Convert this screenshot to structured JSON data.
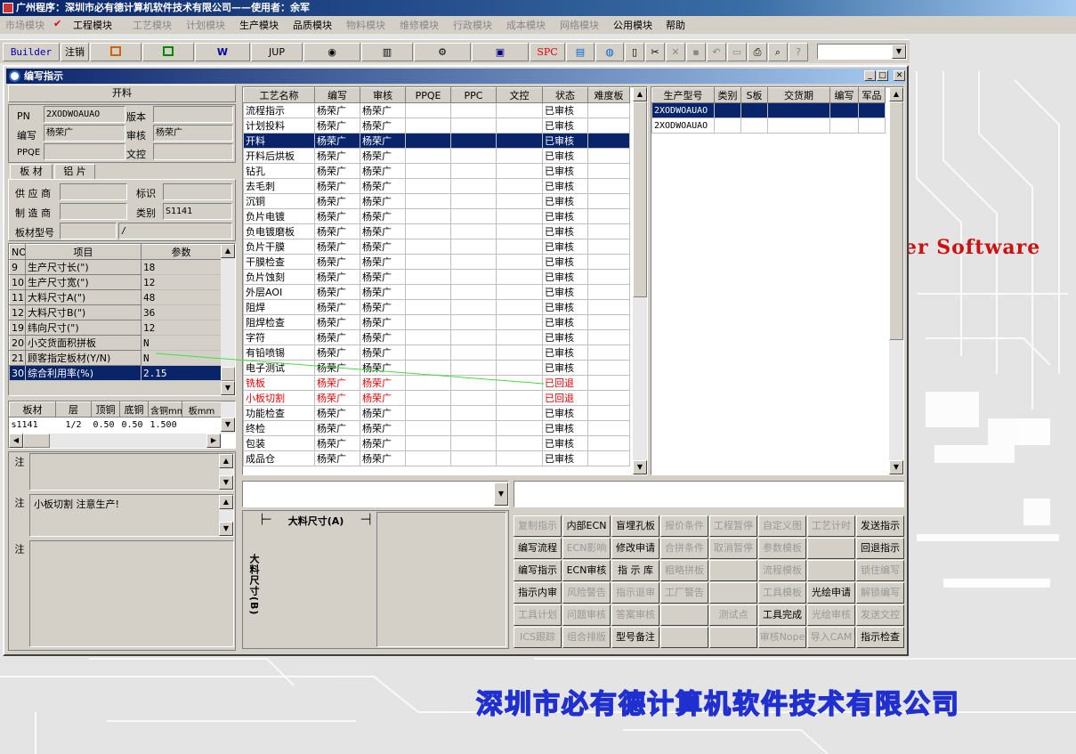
{
  "app_title": "广州程序：深圳市必有德计算机软件技术有限公司——使用者：余军",
  "menu": [
    "市场模块",
    "工程模块",
    "工艺模块",
    "计划模块",
    "生产模块",
    "品质模块",
    "物料模块",
    "维修模块",
    "行政模块",
    "成本模块",
    "网络模块",
    "公用模块",
    "帮助"
  ],
  "toolbar": {
    "builder": "Builder",
    "logout": "注销",
    "jup": "JUP",
    "spc": "SPC"
  },
  "window": {
    "title": "编写指示"
  },
  "left": {
    "section_title": "开料",
    "pn_label": "PN",
    "pn_value": "2XODWOAUAO",
    "version_label": "版本",
    "version_value": "",
    "author_label": "编写",
    "author_value": "杨荣广",
    "reviewer_label": "审核",
    "reviewer_value": "杨荣广",
    "ppqe_label": "PPQE",
    "ppqe_value": "",
    "doc_label": "文控",
    "doc_value": "",
    "tabs": [
      "板 材",
      "铝 片"
    ],
    "supplier_label": "供 应 商",
    "supplier_value": "",
    "mark_label": "标识",
    "mark_value": "",
    "maker_label": "制 造 商",
    "maker_value": "",
    "type_label": "类别",
    "type_value": "S1141",
    "model_label": "板材型号",
    "model_value": "",
    "model_value2": "/"
  },
  "params_table": {
    "headers": [
      "NO",
      "项目",
      "参数"
    ],
    "rows": [
      [
        "9",
        "生产尺寸长(\")",
        "18"
      ],
      [
        "10",
        "生产尺寸宽(\")",
        "12"
      ],
      [
        "11",
        "大料尺寸A(\")",
        "48"
      ],
      [
        "12",
        "大料尺寸B(\")",
        "36"
      ],
      [
        "19",
        "纬向尺寸(\")",
        "12"
      ],
      [
        "20",
        "小交货面积拼板",
        "N"
      ],
      [
        "21",
        "顾客指定板材(Y/N)",
        "N"
      ],
      [
        "30",
        "综合利用率(%)",
        "2.15"
      ]
    ]
  },
  "material_table": {
    "headers": [
      "板材",
      "层",
      "顶铜",
      "底铜",
      "含铜mm",
      "板mm"
    ],
    "row": [
      "s1141",
      "1/2",
      "0.50",
      "0.50",
      "1.500",
      ""
    ]
  },
  "remarks": {
    "process_label": "工艺备注",
    "model_label": "型号备注",
    "model_text": "小板切割 注意生产!",
    "order_label": "订单备注"
  },
  "process_table": {
    "headers": [
      "工艺名称",
      "编写",
      "审核",
      "PPQE",
      "PPC",
      "文控",
      "状态",
      "难度板"
    ],
    "rows": [
      [
        "流程指示",
        "杨荣广",
        "杨荣广",
        "",
        "",
        "",
        "已审核",
        ""
      ],
      [
        "计划投料",
        "杨荣广",
        "杨荣广",
        "",
        "",
        "",
        "已审核",
        ""
      ],
      [
        "开料",
        "杨荣广",
        "杨荣广",
        "",
        "",
        "",
        "已审核",
        ""
      ],
      [
        "开料后烘板",
        "杨荣广",
        "杨荣广",
        "",
        "",
        "",
        "已审核",
        ""
      ],
      [
        "钻孔",
        "杨荣广",
        "杨荣广",
        "",
        "",
        "",
        "已审核",
        ""
      ],
      [
        "去毛刺",
        "杨荣广",
        "杨荣广",
        "",
        "",
        "",
        "已审核",
        ""
      ],
      [
        "沉铜",
        "杨荣广",
        "杨荣广",
        "",
        "",
        "",
        "已审核",
        ""
      ],
      [
        "负片电镀",
        "杨荣广",
        "杨荣广",
        "",
        "",
        "",
        "已审核",
        ""
      ],
      [
        "负电镀磨板",
        "杨荣广",
        "杨荣广",
        "",
        "",
        "",
        "已审核",
        ""
      ],
      [
        "负片干膜",
        "杨荣广",
        "杨荣广",
        "",
        "",
        "",
        "已审核",
        ""
      ],
      [
        "干膜检查",
        "杨荣广",
        "杨荣广",
        "",
        "",
        "",
        "已审核",
        ""
      ],
      [
        "负片蚀刻",
        "杨荣广",
        "杨荣广",
        "",
        "",
        "",
        "已审核",
        ""
      ],
      [
        "外层AOI",
        "杨荣广",
        "杨荣广",
        "",
        "",
        "",
        "已审核",
        ""
      ],
      [
        "阻焊",
        "杨荣广",
        "杨荣广",
        "",
        "",
        "",
        "已审核",
        ""
      ],
      [
        "阻焊检查",
        "杨荣广",
        "杨荣广",
        "",
        "",
        "",
        "已审核",
        ""
      ],
      [
        "字符",
        "杨荣广",
        "杨荣广",
        "",
        "",
        "",
        "已审核",
        ""
      ],
      [
        "有铅喷锡",
        "杨荣广",
        "杨荣广",
        "",
        "",
        "",
        "已审核",
        ""
      ],
      [
        "电子测试",
        "杨荣广",
        "杨荣广",
        "",
        "",
        "",
        "已审核",
        ""
      ],
      [
        "铣板",
        "杨荣广",
        "杨荣广",
        "",
        "",
        "",
        "已回退",
        ""
      ],
      [
        "小板切割",
        "杨荣广",
        "杨荣广",
        "",
        "",
        "",
        "已回退",
        ""
      ],
      [
        "功能检查",
        "杨荣广",
        "杨荣广",
        "",
        "",
        "",
        "已审核",
        ""
      ],
      [
        "终检",
        "杨荣广",
        "杨荣广",
        "",
        "",
        "",
        "已审核",
        ""
      ],
      [
        "包装",
        "杨荣广",
        "杨荣广",
        "",
        "",
        "",
        "已审核",
        ""
      ],
      [
        "成品仓",
        "杨荣广",
        "杨荣广",
        "",
        "",
        "",
        "已审核",
        ""
      ]
    ],
    "selected_index": 2,
    "red_indices": [
      18,
      19
    ]
  },
  "model_table": {
    "headers": [
      "生产型号",
      "类别",
      "S板",
      "交货期",
      "编写",
      "军品"
    ],
    "rows": [
      [
        "2XODWOAUAO",
        "",
        "",
        "",
        "",
        ""
      ],
      [
        "2XODWOAUAO",
        "",
        "",
        "",
        "",
        ""
      ]
    ]
  },
  "diagram": {
    "a_label": "大料尺寸(A)",
    "b_label": "大料尺寸(B)"
  },
  "buttons": [
    [
      "复制指示",
      "内部ECN",
      "盲埋孔板",
      "报价条件",
      "工程暂停",
      "自定义图",
      "工艺计时",
      "发送指示"
    ],
    [
      "编写流程",
      "ECN影响",
      "修改申请",
      "合拼条件",
      "取消暂停",
      "参数模板",
      "",
      "回退指示"
    ],
    [
      "编写指示",
      "ECN审核",
      "指 示 库",
      "粗略拼板",
      "",
      "流程模板",
      "",
      "锁住编写"
    ],
    [
      "指示内审",
      "风险警告",
      "指示退审",
      "工厂警告",
      "",
      "工具模板",
      "光绘申请",
      "解锁编写"
    ],
    [
      "工具计划",
      "问题审核",
      "答案审核",
      "",
      "测试点",
      "工具完成",
      "光绘审核",
      "发送文控"
    ],
    [
      "ICS跟踪",
      "组合排版",
      "型号备注",
      "",
      "",
      "审核Nope",
      "导入CAM",
      "指示检查"
    ]
  ],
  "buttons_enabled": [
    [
      false,
      true,
      true,
      false,
      false,
      false,
      false,
      true
    ],
    [
      true,
      false,
      true,
      false,
      false,
      false,
      false,
      true
    ],
    [
      true,
      true,
      true,
      false,
      false,
      false,
      false,
      false
    ],
    [
      true,
      false,
      false,
      false,
      false,
      false,
      true,
      false
    ],
    [
      false,
      false,
      false,
      false,
      false,
      true,
      false,
      false
    ],
    [
      false,
      false,
      true,
      false,
      false,
      false,
      false,
      true
    ]
  ],
  "background": {
    "software_text": "er Software",
    "company_text": "深圳市必有德计算机软件技术有限公司"
  },
  "colors": {
    "title_blue": "#0a246a",
    "selection": "#0a246a",
    "returned_red": "#e00000",
    "company_blue": "#2030d0",
    "software_red": "#cc1111"
  }
}
